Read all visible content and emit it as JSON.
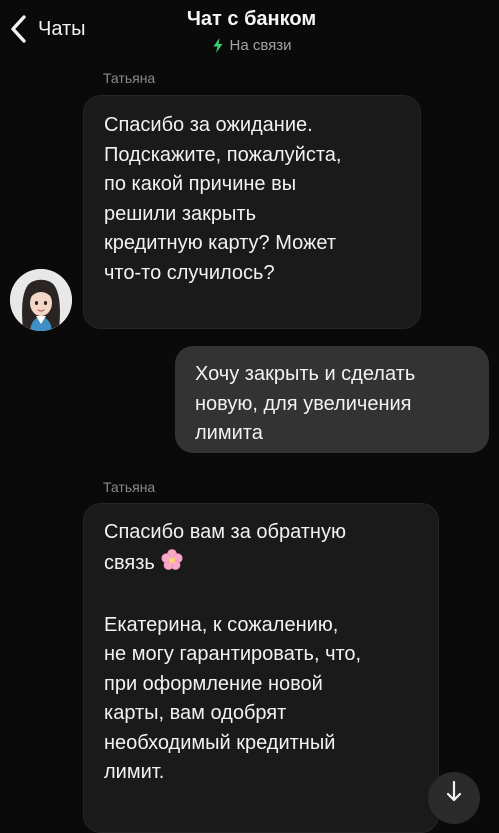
{
  "header": {
    "back_label": "Чаты",
    "title": "Чат с банком",
    "status": "На связи"
  },
  "messages": [
    {
      "direction": "incoming",
      "sender": "Татьяна",
      "lines": [
        "Спасибо за ожидание.",
        "Подскажите, пожалуйста,",
        "по какой причине вы",
        "решили закрыть",
        "кредитную карту? Может",
        "что-то случилось?"
      ]
    },
    {
      "direction": "outgoing",
      "lines": [
        "Хочу закрыть и сделать",
        "новую, для увеличения",
        "лимита"
      ]
    },
    {
      "direction": "incoming",
      "sender": "Татьяна",
      "lines": [
        "Спасибо вам за обратную",
        "связь",
        "",
        "Екатерина, к сожалению,",
        "не могу гарантировать, что,",
        "при оформление новой",
        "карты, вам одобрят",
        "необходимый кредитный",
        "лимит."
      ]
    }
  ],
  "icons": {
    "back": "chevron-left-icon",
    "status": "lightning-bolt-icon",
    "emoji": "cherry-blossom-emoji",
    "scroll": "arrow-down-icon"
  },
  "colors": {
    "background": "#0a0a0a",
    "incoming_bubble": "#1a1a1a",
    "outgoing_bubble": "#333333",
    "online_status": "#3ad26b"
  }
}
